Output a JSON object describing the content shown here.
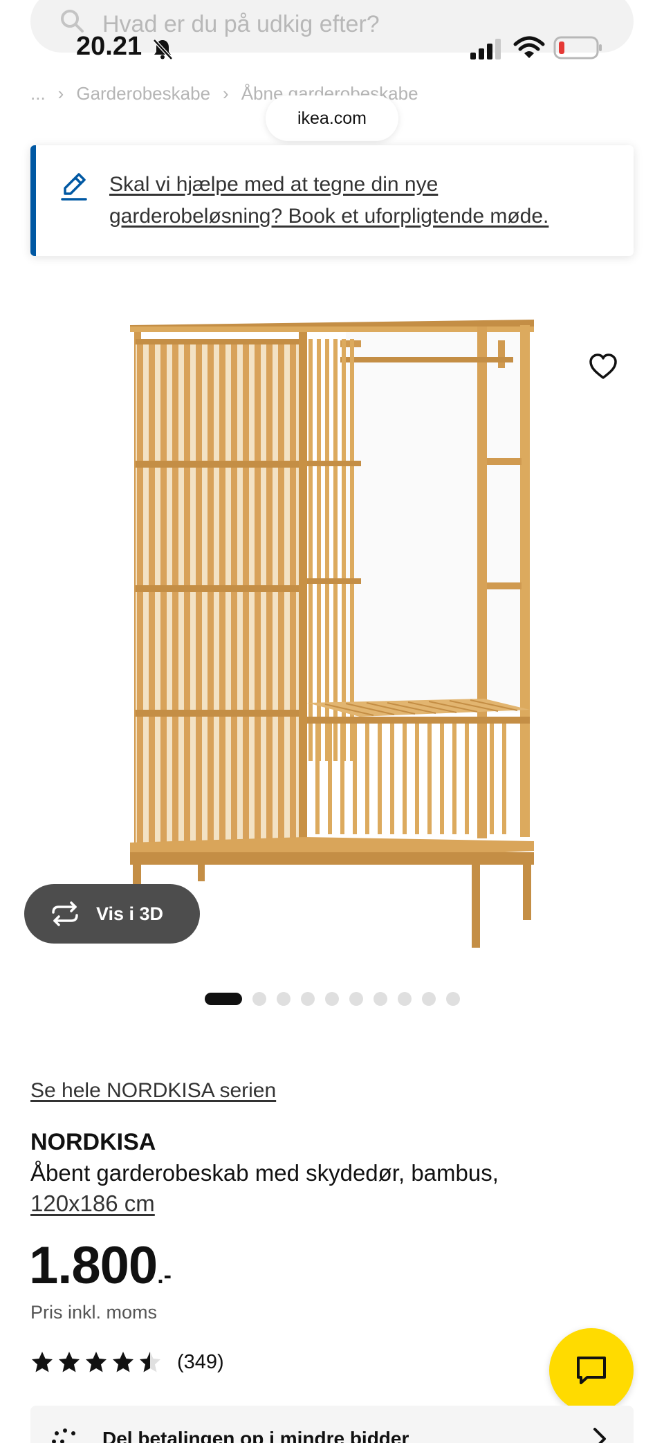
{
  "status_bar": {
    "time": "20.21"
  },
  "search": {
    "placeholder": "Hvad er du på udkig efter?"
  },
  "breadcrumb": {
    "items": [
      "...",
      "Garderobeskabe",
      "Åbne garderobeskabe"
    ]
  },
  "browser": {
    "url": "ikea.com"
  },
  "help_banner": {
    "text": "Skal vi hjælpe med at tegne din nye garderobeløsning? Book et uforpligtende møde."
  },
  "product_image": {
    "view_3d_label": "Vis i 3D",
    "image_count": 10,
    "active_image_index": 0
  },
  "product": {
    "series_link": "Se hele NORDKISA serien",
    "name": "NORDKISA",
    "description": "Åbent garderobeskab med skydedør, bambus,",
    "size": "120x186 cm",
    "price": "1.800",
    "price_suffix": ".-",
    "price_note": "Pris inkl. moms",
    "rating_value": 4.5,
    "rating_max": 5,
    "review_count": "(349)"
  },
  "payment": {
    "text": "Del betalingen op i mindre bidder"
  },
  "colors": {
    "ikea_blue": "#0058a3",
    "ikea_yellow": "#ffdb00",
    "wood": "#d9a55a"
  }
}
